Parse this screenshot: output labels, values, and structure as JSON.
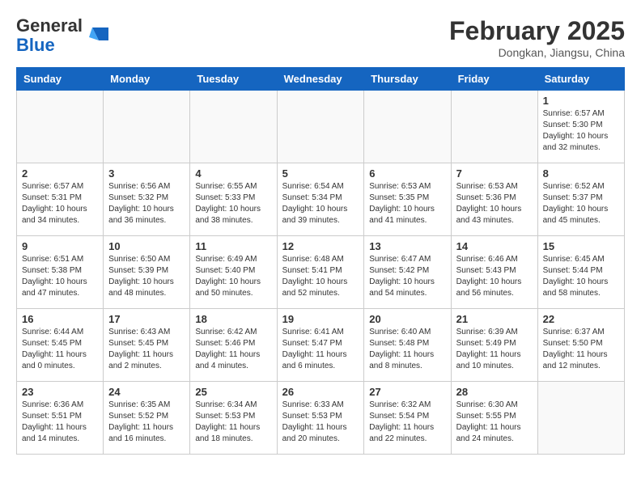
{
  "header": {
    "logo": {
      "general": "General",
      "blue": "Blue",
      "icon_alt": "GeneralBlue Logo"
    },
    "title": "February 2025",
    "location": "Dongkan, Jiangsu, China"
  },
  "weekdays": [
    "Sunday",
    "Monday",
    "Tuesday",
    "Wednesday",
    "Thursday",
    "Friday",
    "Saturday"
  ],
  "weeks": [
    [
      {
        "num": "",
        "info": ""
      },
      {
        "num": "",
        "info": ""
      },
      {
        "num": "",
        "info": ""
      },
      {
        "num": "",
        "info": ""
      },
      {
        "num": "",
        "info": ""
      },
      {
        "num": "",
        "info": ""
      },
      {
        "num": "1",
        "info": "Sunrise: 6:57 AM\nSunset: 5:30 PM\nDaylight: 10 hours and 32 minutes."
      }
    ],
    [
      {
        "num": "2",
        "info": "Sunrise: 6:57 AM\nSunset: 5:31 PM\nDaylight: 10 hours and 34 minutes."
      },
      {
        "num": "3",
        "info": "Sunrise: 6:56 AM\nSunset: 5:32 PM\nDaylight: 10 hours and 36 minutes."
      },
      {
        "num": "4",
        "info": "Sunrise: 6:55 AM\nSunset: 5:33 PM\nDaylight: 10 hours and 38 minutes."
      },
      {
        "num": "5",
        "info": "Sunrise: 6:54 AM\nSunset: 5:34 PM\nDaylight: 10 hours and 39 minutes."
      },
      {
        "num": "6",
        "info": "Sunrise: 6:53 AM\nSunset: 5:35 PM\nDaylight: 10 hours and 41 minutes."
      },
      {
        "num": "7",
        "info": "Sunrise: 6:53 AM\nSunset: 5:36 PM\nDaylight: 10 hours and 43 minutes."
      },
      {
        "num": "8",
        "info": "Sunrise: 6:52 AM\nSunset: 5:37 PM\nDaylight: 10 hours and 45 minutes."
      }
    ],
    [
      {
        "num": "9",
        "info": "Sunrise: 6:51 AM\nSunset: 5:38 PM\nDaylight: 10 hours and 47 minutes."
      },
      {
        "num": "10",
        "info": "Sunrise: 6:50 AM\nSunset: 5:39 PM\nDaylight: 10 hours and 48 minutes."
      },
      {
        "num": "11",
        "info": "Sunrise: 6:49 AM\nSunset: 5:40 PM\nDaylight: 10 hours and 50 minutes."
      },
      {
        "num": "12",
        "info": "Sunrise: 6:48 AM\nSunset: 5:41 PM\nDaylight: 10 hours and 52 minutes."
      },
      {
        "num": "13",
        "info": "Sunrise: 6:47 AM\nSunset: 5:42 PM\nDaylight: 10 hours and 54 minutes."
      },
      {
        "num": "14",
        "info": "Sunrise: 6:46 AM\nSunset: 5:43 PM\nDaylight: 10 hours and 56 minutes."
      },
      {
        "num": "15",
        "info": "Sunrise: 6:45 AM\nSunset: 5:44 PM\nDaylight: 10 hours and 58 minutes."
      }
    ],
    [
      {
        "num": "16",
        "info": "Sunrise: 6:44 AM\nSunset: 5:45 PM\nDaylight: 11 hours and 0 minutes."
      },
      {
        "num": "17",
        "info": "Sunrise: 6:43 AM\nSunset: 5:45 PM\nDaylight: 11 hours and 2 minutes."
      },
      {
        "num": "18",
        "info": "Sunrise: 6:42 AM\nSunset: 5:46 PM\nDaylight: 11 hours and 4 minutes."
      },
      {
        "num": "19",
        "info": "Sunrise: 6:41 AM\nSunset: 5:47 PM\nDaylight: 11 hours and 6 minutes."
      },
      {
        "num": "20",
        "info": "Sunrise: 6:40 AM\nSunset: 5:48 PM\nDaylight: 11 hours and 8 minutes."
      },
      {
        "num": "21",
        "info": "Sunrise: 6:39 AM\nSunset: 5:49 PM\nDaylight: 11 hours and 10 minutes."
      },
      {
        "num": "22",
        "info": "Sunrise: 6:37 AM\nSunset: 5:50 PM\nDaylight: 11 hours and 12 minutes."
      }
    ],
    [
      {
        "num": "23",
        "info": "Sunrise: 6:36 AM\nSunset: 5:51 PM\nDaylight: 11 hours and 14 minutes."
      },
      {
        "num": "24",
        "info": "Sunrise: 6:35 AM\nSunset: 5:52 PM\nDaylight: 11 hours and 16 minutes."
      },
      {
        "num": "25",
        "info": "Sunrise: 6:34 AM\nSunset: 5:53 PM\nDaylight: 11 hours and 18 minutes."
      },
      {
        "num": "26",
        "info": "Sunrise: 6:33 AM\nSunset: 5:53 PM\nDaylight: 11 hours and 20 minutes."
      },
      {
        "num": "27",
        "info": "Sunrise: 6:32 AM\nSunset: 5:54 PM\nDaylight: 11 hours and 22 minutes."
      },
      {
        "num": "28",
        "info": "Sunrise: 6:30 AM\nSunset: 5:55 PM\nDaylight: 11 hours and 24 minutes."
      },
      {
        "num": "",
        "info": ""
      }
    ]
  ]
}
